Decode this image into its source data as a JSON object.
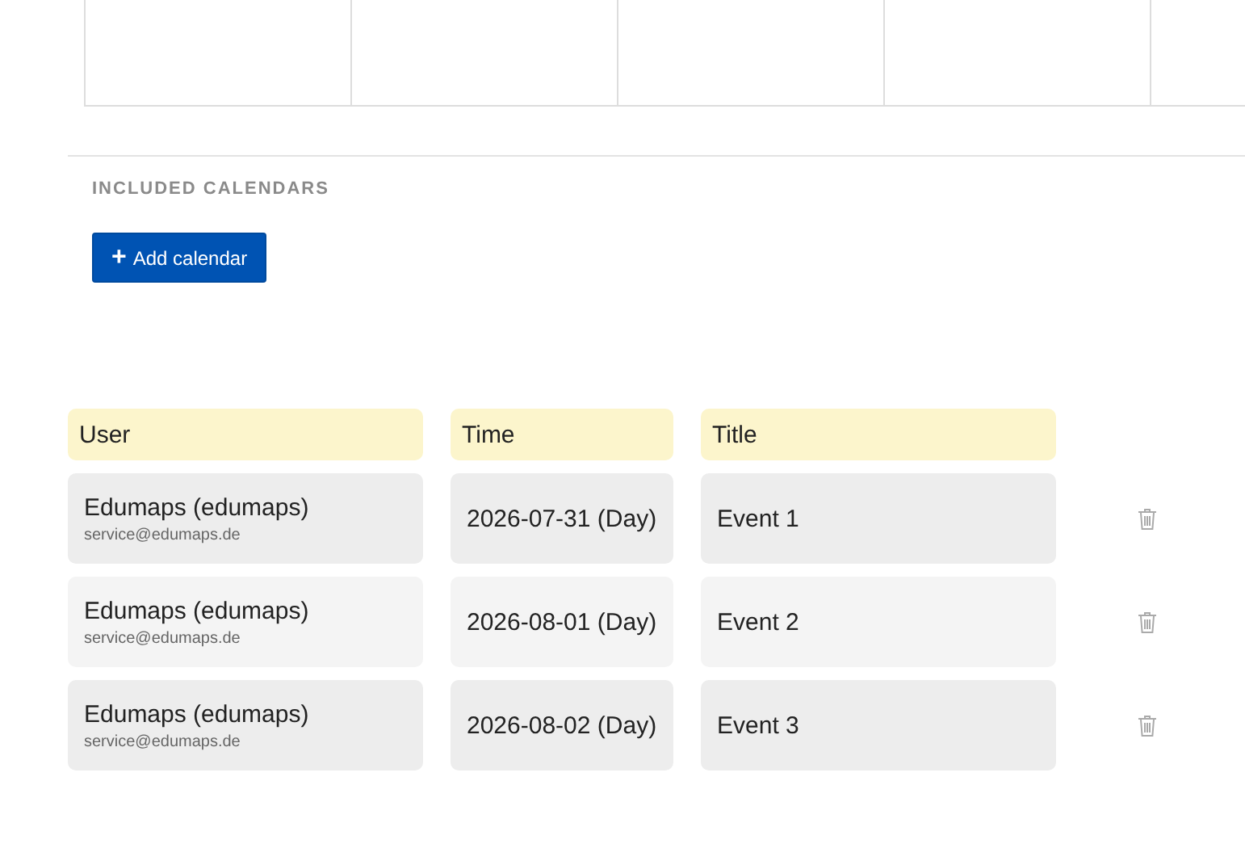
{
  "section": {
    "heading": "INCLUDED CALENDARS",
    "add_button": {
      "icon": "+",
      "label": "Add calendar"
    }
  },
  "table": {
    "columns": [
      "User",
      "Time",
      "Title"
    ],
    "rows": [
      {
        "user": "Edumaps (edumaps)",
        "email": "service@edumaps.de",
        "time": "2026-07-31 (Day)",
        "title": "Event 1"
      },
      {
        "user": "Edumaps (edumaps)",
        "email": "service@edumaps.de",
        "time": "2026-08-01 (Day)",
        "title": "Event 2"
      },
      {
        "user": "Edumaps (edumaps)",
        "email": "service@edumaps.de",
        "time": "2026-08-02 (Day)",
        "title": "Event 3"
      }
    ]
  }
}
